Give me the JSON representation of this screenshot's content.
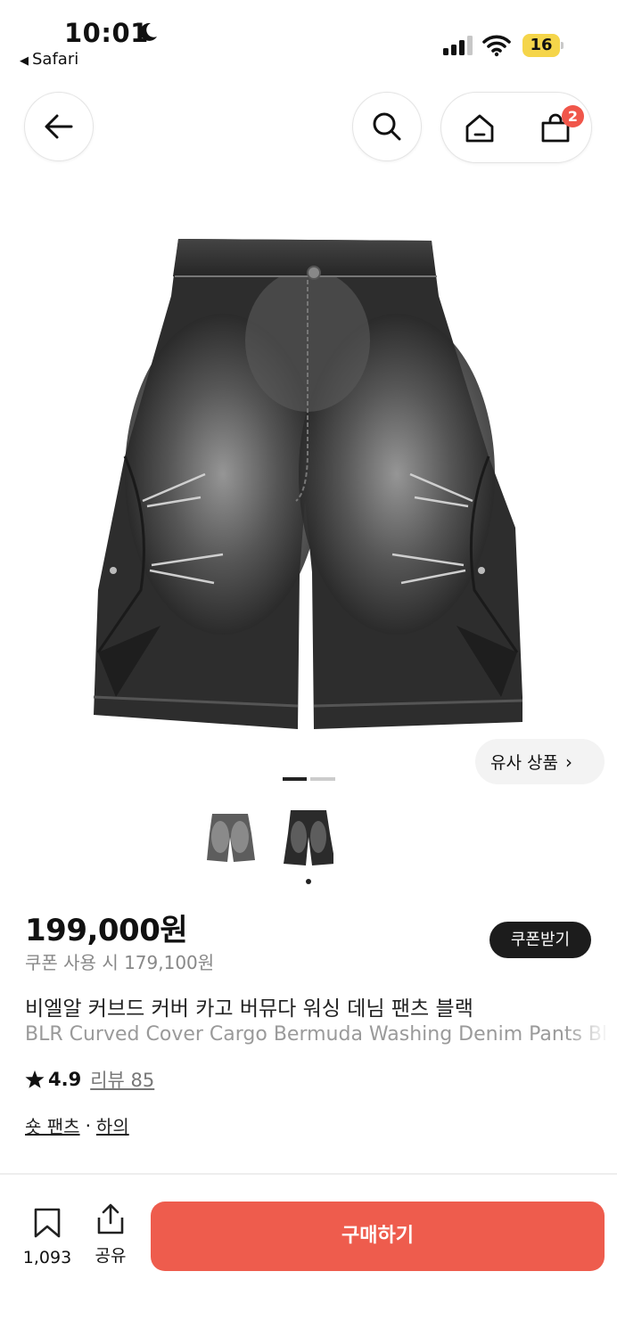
{
  "status_bar": {
    "time": "10:01",
    "back_app": "Safari",
    "battery": "16",
    "battery_color": "#f5d54a"
  },
  "nav": {
    "back_icon": "arrow-left-icon",
    "search_icon": "search-icon",
    "home_icon": "home-icon",
    "cart_icon": "shopping-bag-icon",
    "cart_count": "2",
    "badge_color": "#f0564a"
  },
  "gallery": {
    "image_count": 2,
    "current_index": 1,
    "similar_label": "유사 상품",
    "thumbnails": [
      "thumbnail-gray",
      "thumbnail-black"
    ]
  },
  "product": {
    "price": "199,000원",
    "coupon_price": "쿠폰 사용 시 179,100원",
    "coupon_button": "쿠폰받기",
    "title_ko": "비엘알 커브드 커버 카고 버뮤다 워싱 데님 팬츠 블랙",
    "title_en": "BLR Curved Cover Cargo Bermuda Washing Denim Pants Black",
    "rating": "4.9",
    "reviews": "리뷰 85",
    "category_1": "숏 팬츠",
    "category_sep": "·",
    "category_2": "하의"
  },
  "bottom_bar": {
    "save_count": "1,093",
    "share_label": "공유",
    "buy_label": "구매하기",
    "buy_color": "#ee5c4d"
  }
}
